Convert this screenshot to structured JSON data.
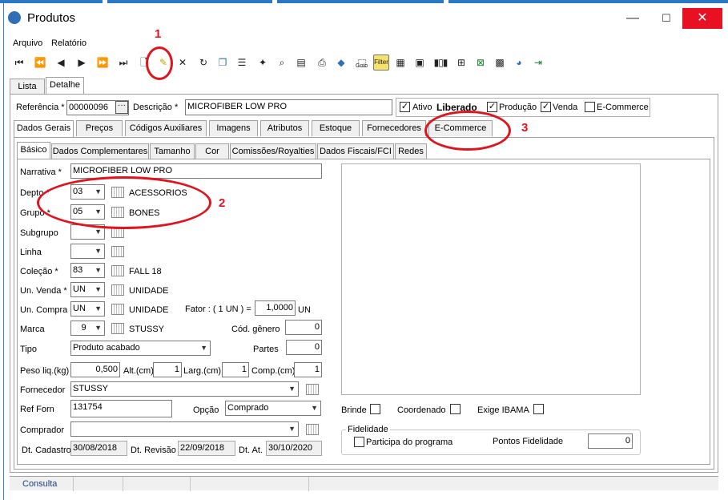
{
  "window": {
    "title": "Produtos",
    "minimize": "—",
    "maximize": "☐",
    "close": "✕"
  },
  "menu": [
    "Arquivo",
    "Relatório"
  ],
  "toolbar": {
    "icons": [
      "first-record-icon",
      "previous-page-icon",
      "previous-record-icon",
      "next-record-icon",
      "next-page-icon",
      "last-record-icon",
      "new-record-icon",
      "edit-record-icon",
      "delete-record-icon",
      "refresh-icon",
      "copy-icon",
      "properties-icon",
      "magic-wand-icon",
      "search-document-icon",
      "document-icon",
      "print-icon",
      "tag-icon",
      "goto-icon",
      "filter-icon",
      "calculator-icon",
      "image-icon",
      "barcode-icon",
      "table-icon",
      "excel-export-icon",
      "grid-icon",
      "chart-icon",
      "exit-icon"
    ],
    "goto_label": "Goto",
    "filter_label": "Filter"
  },
  "main_tabs": [
    "Lista",
    "Detalhe"
  ],
  "header": {
    "referencia_label": "Referência *",
    "referencia_value": "00000096",
    "descricao_label": "Descrição *",
    "descricao_value": "MICROFIBER LOW PRO",
    "ativo_label": "Ativo",
    "status_text": "Liberado",
    "producao_label": "Produção",
    "venda_label": "Venda",
    "ecommerce_label": "E-Commerce"
  },
  "section_tabs": [
    "Dados Gerais",
    "Preços",
    "Códigos Auxiliares",
    "Imagens",
    "Atributos",
    "Estoque",
    "Fornecedores",
    "E-Commerce"
  ],
  "sub_tabs": [
    "Básico",
    "Dados Complementares",
    "Tamanho",
    "Cor",
    "Comissões/Royalties",
    "Dados Fiscais/FCI",
    "Redes"
  ],
  "form": {
    "narrativa_label": "Narrativa *",
    "narrativa_value": "MICROFIBER LOW PRO",
    "depto_label": "Depto *",
    "depto_code": "03",
    "depto_name": "ACESSORIOS",
    "grupo_label": "Grupo *",
    "grupo_code": "05",
    "grupo_name": "BONES",
    "subgrupo_label": "Subgrupo",
    "linha_label": "Linha",
    "colecao_label": "Coleção *",
    "colecao_code": "83",
    "colecao_name": "FALL 18",
    "un_venda_label": "Un. Venda *",
    "un_venda_code": "UN",
    "un_venda_name": "UNIDADE",
    "un_compra_label": "Un. Compra",
    "un_compra_code": "UN",
    "un_compra_name": "UNIDADE",
    "fator_label": "Fator : ( 1 UN ) =",
    "fator_value": "1,0000",
    "fator_unit": "UN",
    "marca_label": "Marca",
    "marca_code": "9",
    "marca_name": "STUSSY",
    "cod_genero_label": "Cód. gênero",
    "cod_genero_value": "0",
    "tipo_label": "Tipo",
    "tipo_value": "Produto acabado",
    "partes_label": "Partes",
    "partes_value": "0",
    "peso_label": "Peso liq.(kg)",
    "peso_value": "0,500",
    "alt_label": "Alt.(cm)",
    "alt_value": "1",
    "larg_label": "Larg.(cm)",
    "larg_value": "1",
    "comp_label": "Comp.(cm)",
    "comp_value": "1",
    "fornecedor_label": "Fornecedor",
    "fornecedor_value": "STUSSY",
    "ref_forn_label": "Ref Forn",
    "ref_forn_value": "131754",
    "opcao_label": "Opção",
    "opcao_value": "Comprado",
    "comprador_label": "Comprador",
    "comprador_value": "",
    "dt_cadastro_label": "Dt. Cadastro",
    "dt_cadastro_value": "30/08/2018",
    "dt_revisao_label": "Dt. Revisão",
    "dt_revisao_value": "22/09/2018",
    "dt_at_label": "Dt. At.",
    "dt_at_value": "30/10/2020",
    "brinde_label": "Brinde",
    "coordenado_label": "Coordenado",
    "exige_ibama_label": "Exige IBAMA",
    "fidelidade_label": "Fidelidade",
    "participa_label": "Participa do programa",
    "pontos_label": "Pontos Fidelidade",
    "pontos_value": "0"
  },
  "annotations": [
    "1",
    "2",
    "3"
  ],
  "status": {
    "consulta": "Consulta"
  },
  "colors": {
    "accent": "#2b78c4",
    "annotation": "#e0141e",
    "close": "#e81123"
  }
}
